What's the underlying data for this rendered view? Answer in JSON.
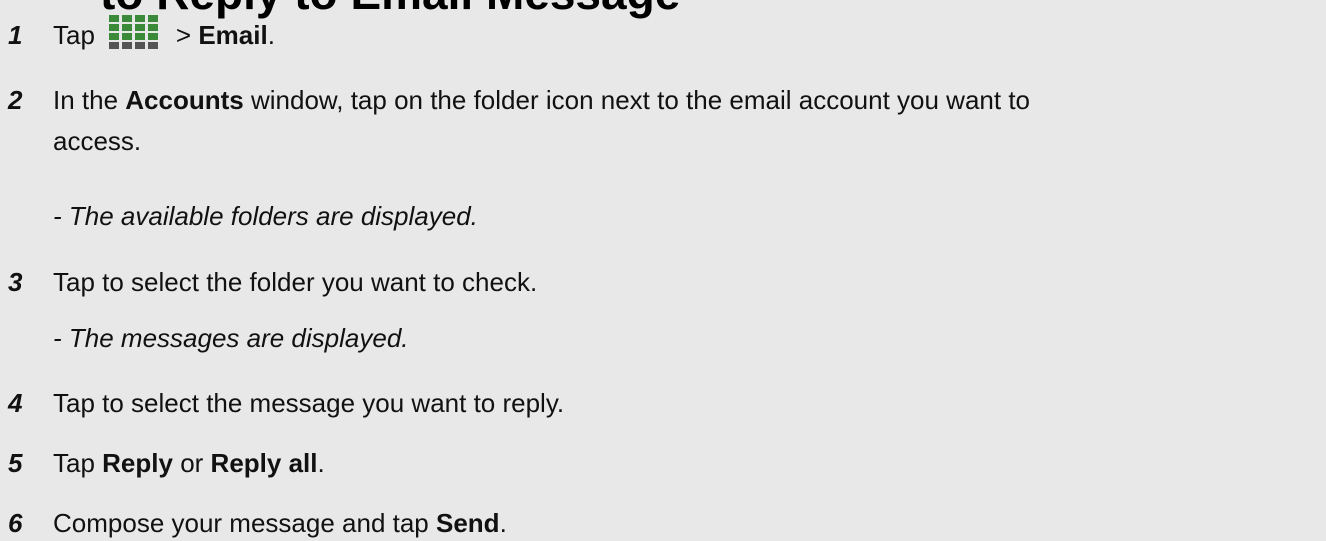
{
  "heading": "to Reply to Email Message",
  "steps": [
    {
      "num": "1",
      "pre": "Tap",
      "icon": "apps-grid-icon",
      "mid": "> ",
      "bold": "Email",
      "post": "."
    },
    {
      "num": "2",
      "line1_pre": "In the ",
      "line1_bold": "Accounts",
      "line1_post": " window, tap on the folder icon next to the email account you want to",
      "line2": "access.",
      "note": "- The available folders are displayed."
    },
    {
      "num": "3",
      "text": "Tap to select the folder you want to check.",
      "note": "- The messages are displayed."
    },
    {
      "num": "4",
      "text": "Tap to select the message you want to reply."
    },
    {
      "num": "5",
      "pre": "Tap ",
      "bold1": "Reply",
      "mid": " or ",
      "bold2": "Reply all",
      "post": "."
    },
    {
      "num": "6",
      "pre": "Compose your message and tap ",
      "bold": "Send",
      "post": "."
    }
  ],
  "colors": {
    "background": "#e8e8e8",
    "text": "#111111"
  }
}
